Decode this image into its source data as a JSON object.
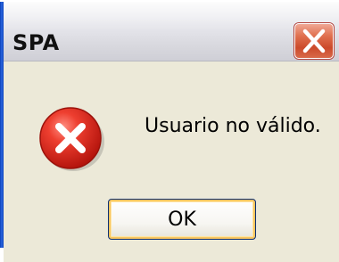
{
  "window": {
    "title": "SPA",
    "close_icon": "close-icon"
  },
  "dialog": {
    "icon": "error-icon",
    "message": "Usuario no válido.",
    "ok_label": "OK"
  },
  "colors": {
    "titlebar_top": "#fcfcfc",
    "titlebar_bottom": "#cfcfd6",
    "client_background": "#ece9d8",
    "close_button": "#cc4a2b",
    "error_red": "#e2231a",
    "ok_focus_border": "#f8c55f"
  }
}
